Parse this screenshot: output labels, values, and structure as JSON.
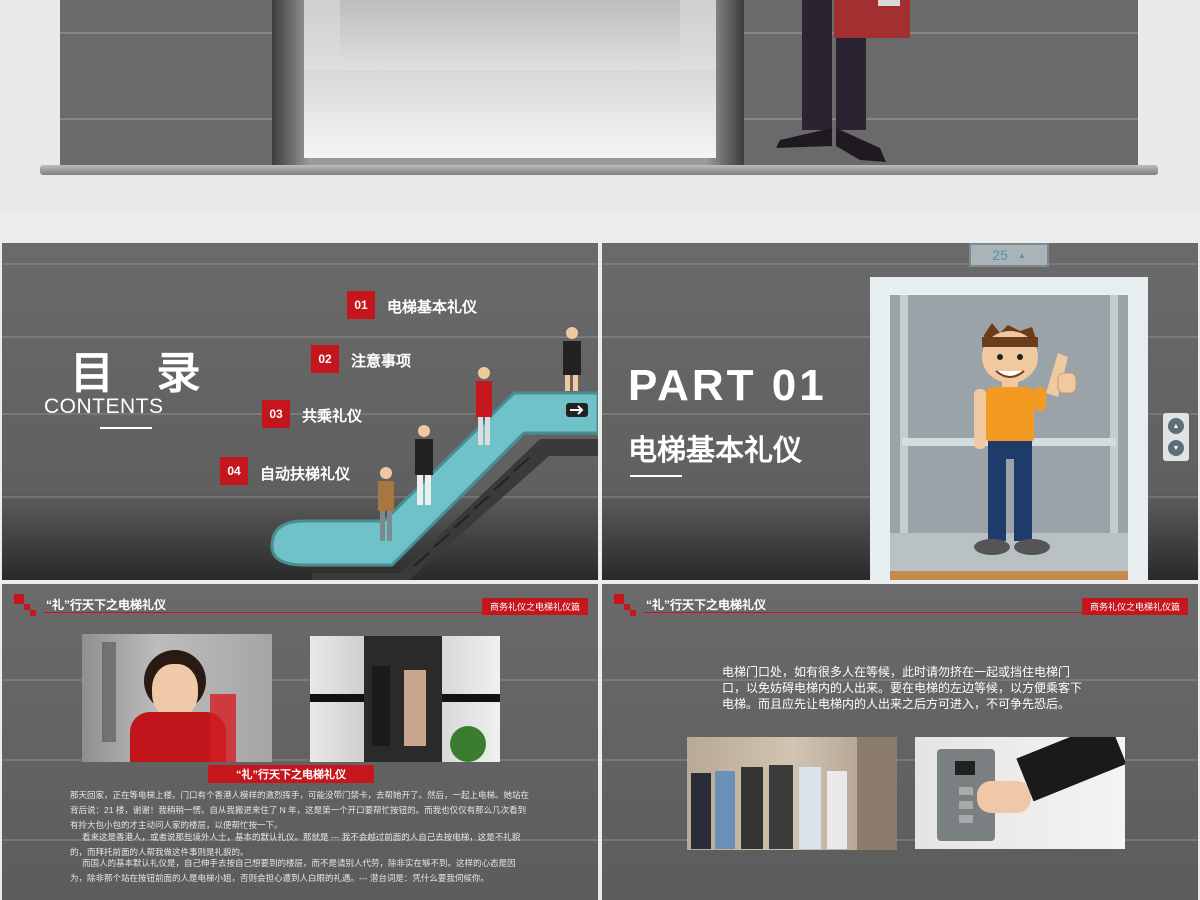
{
  "slide_contents": {
    "heading": "目  录",
    "subheading": "CONTENTS",
    "items": [
      {
        "num": "01",
        "label": "电梯基本礼仪"
      },
      {
        "num": "02",
        "label": "注意事项"
      },
      {
        "num": "03",
        "label": "共乘礼仪"
      },
      {
        "num": "04",
        "label": "自动扶梯礼仪"
      }
    ]
  },
  "slide_part": {
    "part_label": "PART 01",
    "title": "电梯基本礼仪",
    "floor_display": "25"
  },
  "slide_article": {
    "header_title": "“礼”行天下之电梯礼仪",
    "header_badge": "商务礼仪之电梯礼仪篇",
    "caption": "“礼”行天下之电梯礼仪",
    "paragraphs": [
      "那天回家，正在等电梯上楼。门口有个香港人模样的激烈挥手，可能没带门禁卡，去帮她开了。然后，一起上电梯。她站在背后说：21 楼，谢谢！我稍稍一愣。自从我搬进来住了 N 年，这是第一个开口要帮忙按钮的。而我也仅仅有那么几次看到有拎大包小包的才主动问人家的楼层，以便帮忙按一下。",
      "看来这是香港人，或者说那些境外人士，基本的默认礼仪。那就是 --- 我不会越过前面的人自己去按电梯，这是不礼貌的，而拜托前面的人帮我做这件事则是礼貌的。",
      "而国人的基本默认礼仪是，自己伸手去按自己想要到的楼层，而不是请别人代劳，除非实在够不到。这样的心态是因为，除非那个站在按钮前面的人是电梯小姐，否则会担心遭到人白眼的礼遇。--- 潜台词是：凭什么要我伺候你。"
    ]
  },
  "slide_tips": {
    "header_title": "“礼”行天下之电梯礼仪",
    "header_badge": "商务礼仪之电梯礼仪篇",
    "paragraph": "电梯门口处，如有很多人在等候，此时请勿挤在一起或挡住电梯门口，以免妨碍电梯内的人出来。要在电梯的左边等候，以方便乘客下电梯。而且应先让电梯内的人出来之后方可进入，不可争先恐后。"
  },
  "colors": {
    "accent": "#c4161c",
    "slide_bg": "#5e5e5e",
    "escalator": "#6fc3c8"
  }
}
